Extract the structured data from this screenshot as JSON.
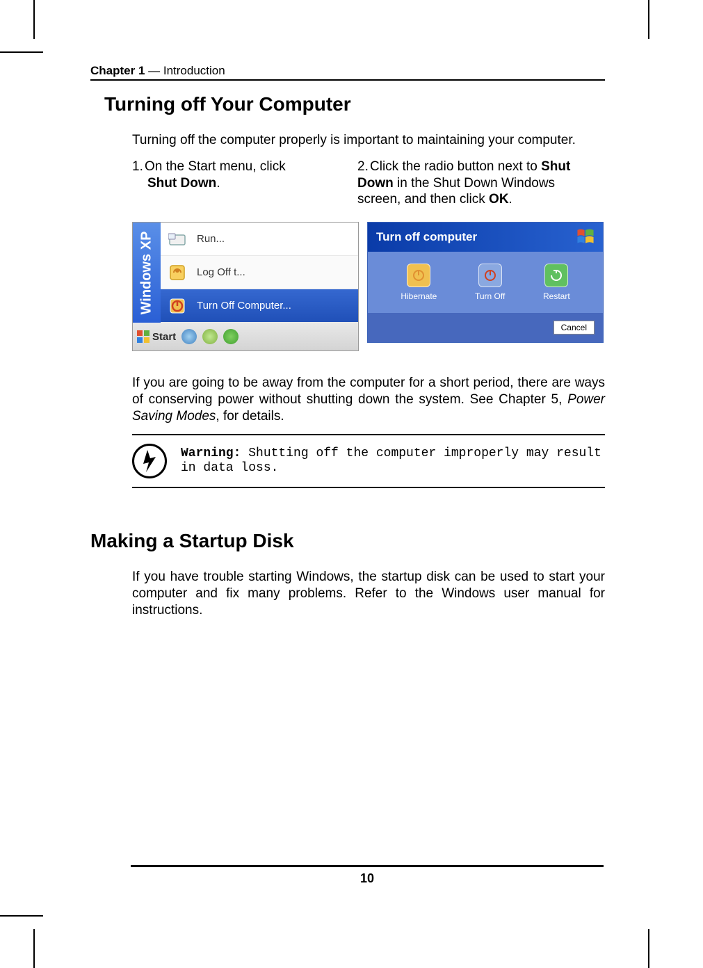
{
  "header": {
    "chapter": "Chapter 1",
    "dash": " — ",
    "section": "Introduction"
  },
  "h2a": "Turning off Your Computer",
  "intro": "Turning off the computer properly is important to maintaining your computer.",
  "step1_num": "1.",
  "step1_a": "On the Start menu, click",
  "step1_b": "Shut Down",
  "step1_c": ".",
  "step2_num": "2.",
  "step2_a": "Click the radio button next to ",
  "step2_b": "Shut Down",
  "step2_c": " in the Shut Down Windows screen, and then click ",
  "step2_d": "OK",
  "step2_e": ".",
  "start_menu": {
    "sidebar": "Windows XP",
    "run": "Run...",
    "logoff": "Log Off t...",
    "turnoff": "Turn Off Computer...",
    "start": "Start"
  },
  "dialog": {
    "title": "Turn off computer",
    "hibernate": "Hibernate",
    "turnoff": "Turn Off",
    "restart": "Restart",
    "cancel": "Cancel"
  },
  "para2_a": "If you are going to be away from the computer for a short period, there are ways of conserving power without shutting down the system. See Chapter 5, ",
  "para2_b": "Power Saving Modes",
  "para2_c": ", for details.",
  "warning_label": "Warning:",
  "warning_text": " Shutting off the computer improperly may result in data loss.",
  "h2b": "Making a Startup Disk",
  "para3": "If you have trouble starting Windows, the startup disk can be used to start your computer and fix many problems. Refer to the Windows user manual for instructions.",
  "page_number": "10"
}
